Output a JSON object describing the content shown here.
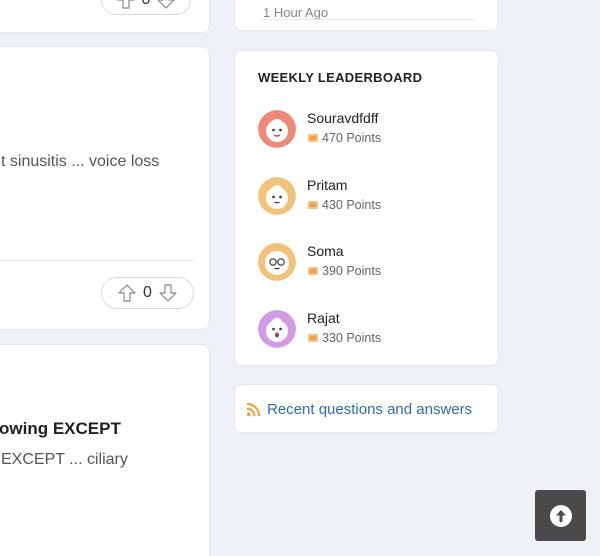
{
  "questions": [
    {
      "title": "",
      "excerpt": "",
      "votes": "0"
    },
    {
      "title": "",
      "excerpt": "t sinusitis ... voice loss",
      "votes": "0"
    },
    {
      "title": "owing EXCEPT",
      "excerpt": "EXCEPT ... ciliary",
      "votes": ""
    }
  ],
  "recent": {
    "time": "1 Hour Ago"
  },
  "leaderboard": {
    "title": "WEEKLY LEADERBOARD",
    "entries": [
      {
        "name": "Souravdfdff",
        "points": "470 Points",
        "avatar_color": "#f08a78",
        "avatar_icon": "creature-avatar-icon"
      },
      {
        "name": "Pritam",
        "points": "430 Points",
        "avatar_color": "#f3c27a",
        "avatar_icon": "creature-avatar-icon"
      },
      {
        "name": "Soma",
        "points": "390 Points",
        "avatar_color": "#f3c27a",
        "avatar_icon": "glasses-creature-avatar-icon"
      },
      {
        "name": "Rajat",
        "points": "330 Points",
        "avatar_color": "#d39be3",
        "avatar_icon": "creature-avatar-icon"
      }
    ]
  },
  "feed": {
    "label": "Recent questions and answers",
    "icon": "rss-icon",
    "icon_color": "#f0a030",
    "link_color": "#2f6db1"
  },
  "scroll_top": {
    "icon": "arrow-up-circle-icon"
  }
}
